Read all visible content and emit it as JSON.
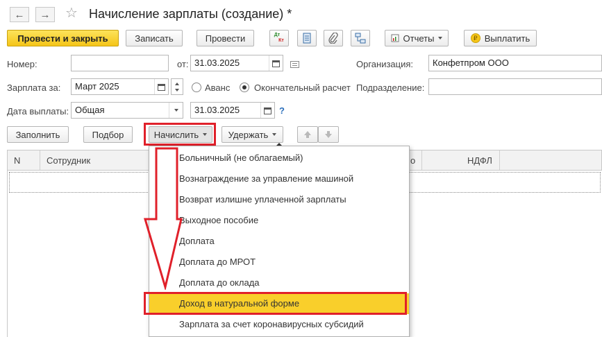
{
  "window": {
    "title": "Начисление зарплаты (создание) *"
  },
  "nav": {
    "back": "←",
    "forward": "→",
    "favorite": "☆"
  },
  "toolbar": {
    "post_close": "Провести и закрыть",
    "save": "Записать",
    "post": "Провести",
    "dtkt_top": "Дт",
    "dtkt_bottom": "Кт",
    "reports": "Отчеты",
    "pay": "Выплатить"
  },
  "form": {
    "number_label": "Номер:",
    "number_value": "",
    "from_label": "от:",
    "date_value": "31.03.2025",
    "org_label": "Организация:",
    "org_value": "Конфетпром ООО",
    "salary_for_label": "Зарплата за:",
    "salary_for_value": "Март 2025",
    "advance_label": "Аванс",
    "final_label": "Окончательный расчет",
    "final_selected": true,
    "division_label": "Подразделение:",
    "division_value": "",
    "pay_date_label": "Дата выплаты:",
    "pay_date_type": "Общая",
    "pay_date_value": "31.03.2025",
    "help": "?"
  },
  "actions": {
    "fill": "Заполнить",
    "select": "Подбор",
    "accrue": "Начислить",
    "withhold": "Удержать"
  },
  "table": {
    "columns": [
      "N",
      "Сотрудник",
      "о",
      "НДФЛ"
    ]
  },
  "menu": {
    "items": [
      "Больничный (не облагаемый)",
      "Вознаграждение за управление машиной",
      "Возврат излишне уплаченной зарплаты",
      "Выходное пособие",
      "Доплата",
      "Доплата до МРОТ",
      "Доплата до оклада",
      "Доход в натуральной форме",
      "Зарплата за счет коронавирусных субсидий"
    ],
    "highlighted_index": 7
  },
  "colors": {
    "accent": "#f5c518",
    "highlight": "#f9cf2b",
    "annotation": "#e0202a"
  }
}
